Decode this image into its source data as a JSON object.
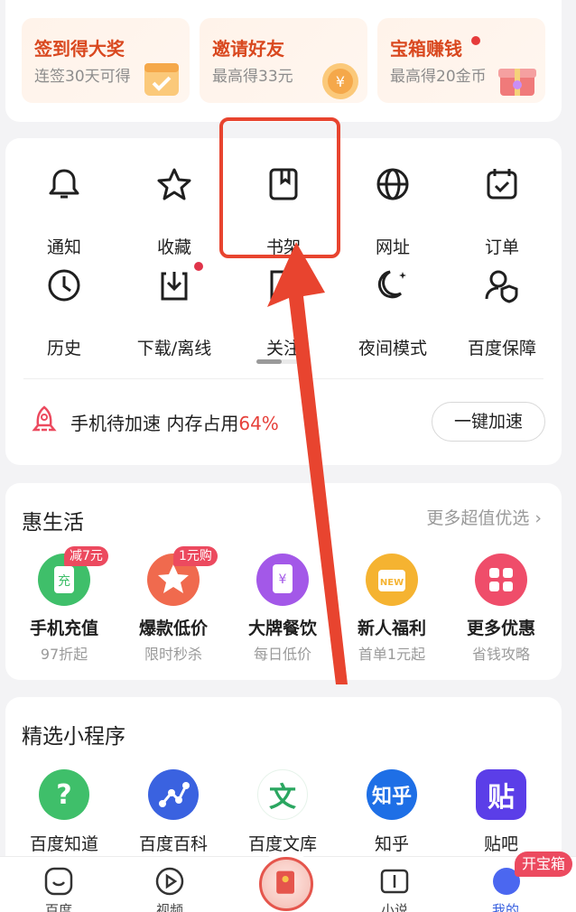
{
  "rewards": [
    {
      "title": "签到得大奖",
      "subtitle": "连签30天可得",
      "has_dot": false,
      "art": "calendar-icon"
    },
    {
      "title": "邀请好友",
      "subtitle": "最高得33元",
      "has_dot": false,
      "art": "coin-icon"
    },
    {
      "title": "宝箱赚钱",
      "subtitle": "最高得20金币",
      "has_dot": true,
      "art": "gift-box-icon"
    }
  ],
  "tools": {
    "row1": [
      "通知",
      "收藏",
      "书架",
      "网址",
      "订单"
    ],
    "row2": [
      "历史",
      "下载/离线",
      "关注",
      "夜间模式",
      "百度保障"
    ]
  },
  "speed": {
    "text": "手机待加速 内存占用",
    "percent": "64%",
    "button": "一键加速"
  },
  "life": {
    "title": "惠生活",
    "more": "更多超值优选",
    "items": [
      {
        "name": "手机充值",
        "sub": "97折起",
        "badge": "减7元",
        "color": "#3fbf6a",
        "glyph": "充"
      },
      {
        "name": "爆款低价",
        "sub": "限时秒杀",
        "badge": "1元购",
        "color": "#f06a4e",
        "glyph": "★"
      },
      {
        "name": "大牌餐饮",
        "sub": "每日低价",
        "badge": "",
        "color": "#a358e8",
        "glyph": "¥"
      },
      {
        "name": "新人福利",
        "sub": "首单1元起",
        "badge": "",
        "color": "#f5b331",
        "glyph": "NEW"
      },
      {
        "name": "更多优惠",
        "sub": "省钱攻略",
        "badge": "",
        "color": "#ef4d6a",
        "glyph": "▦"
      }
    ]
  },
  "mini": {
    "title": "精选小程序",
    "items": [
      {
        "name": "百度知道",
        "glyph": "?",
        "color": "#3fbf6a",
        "text_color": "#ffffff"
      },
      {
        "name": "百度百科",
        "glyph": "⋰",
        "color": "#3a62e0",
        "text_color": "#ffffff"
      },
      {
        "name": "百度文库",
        "glyph": "文",
        "color": "#ffffff",
        "text_color": "#2aa660"
      },
      {
        "name": "知乎",
        "glyph": "知乎",
        "color": "#1e6fe6",
        "text_color": "#ffffff"
      },
      {
        "name": "贴吧",
        "glyph": "贴",
        "color": "#5b3ee8",
        "text_color": "#ffffff"
      }
    ]
  },
  "nav": {
    "items": [
      "百度",
      "视频",
      "",
      "小说",
      "我的"
    ],
    "treasure_badge": "开宝箱"
  },
  "colors": {
    "accent": "#e6403a",
    "badge": "#ec4a5f",
    "highlight": "#e8442f"
  }
}
